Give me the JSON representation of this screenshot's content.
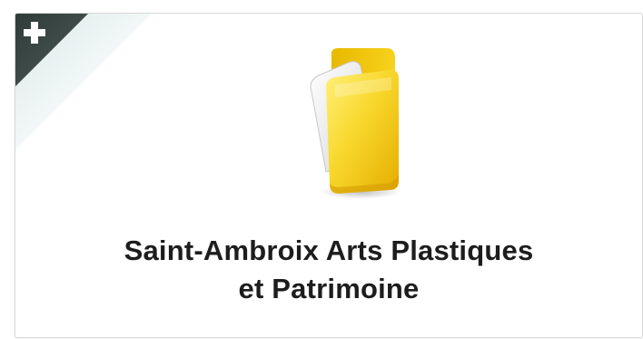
{
  "tile": {
    "title_line1": "Saint-Ambroix Arts Plastiques",
    "title_line2": "et Patrimoine",
    "icon": "folder-icon",
    "corner_action_icon": "plus-icon"
  },
  "colors": {
    "corner_dark": "#3c4a48",
    "corner_fade": "#dfeceb",
    "folder_yellow": "#f6d32a",
    "folder_shadow": "#d9a800",
    "paper": "#f2f2f2",
    "text": "#1d1d1d"
  }
}
